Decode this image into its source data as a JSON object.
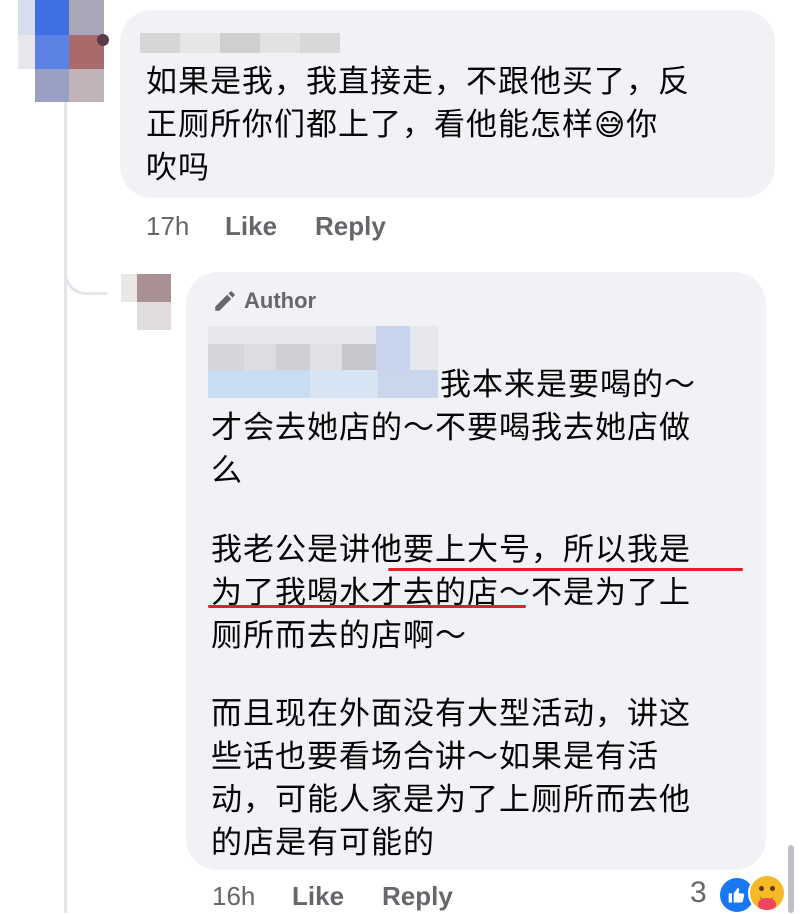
{
  "comment1": {
    "lines": [
      "如果是我，我直接走，不跟他买了，反",
      "正厕所你们都上了，看他能怎样",
      "你",
      "吹吗"
    ],
    "emoji": "😅",
    "time": "17h",
    "like_label": "Like",
    "reply_label": "Reply"
  },
  "reply1": {
    "badge": "Author",
    "lines": [
      "我本来是要喝的～",
      "才会去她店的～不要喝我去她店做",
      "么",
      "我老公是讲他要上大号，所以我是",
      "为了我喝水才去的店～不是为了上",
      "厕所而去的店啊～",
      "而且现在外面没有大型活动，讲这",
      "些话也要看场合讲～如果是有活",
      "动，可能人家是为了上厕所而去他",
      "的店是有可能的"
    ],
    "time": "16h",
    "like_label": "Like",
    "reply_label": "Reply",
    "reaction_count": "3"
  },
  "colors": {
    "bubble": "#f0f2f5",
    "meta_text": "#65676b",
    "underline": "#e01f2a",
    "like_blue": "#1877f2",
    "care_yellow": "#f7b928"
  }
}
